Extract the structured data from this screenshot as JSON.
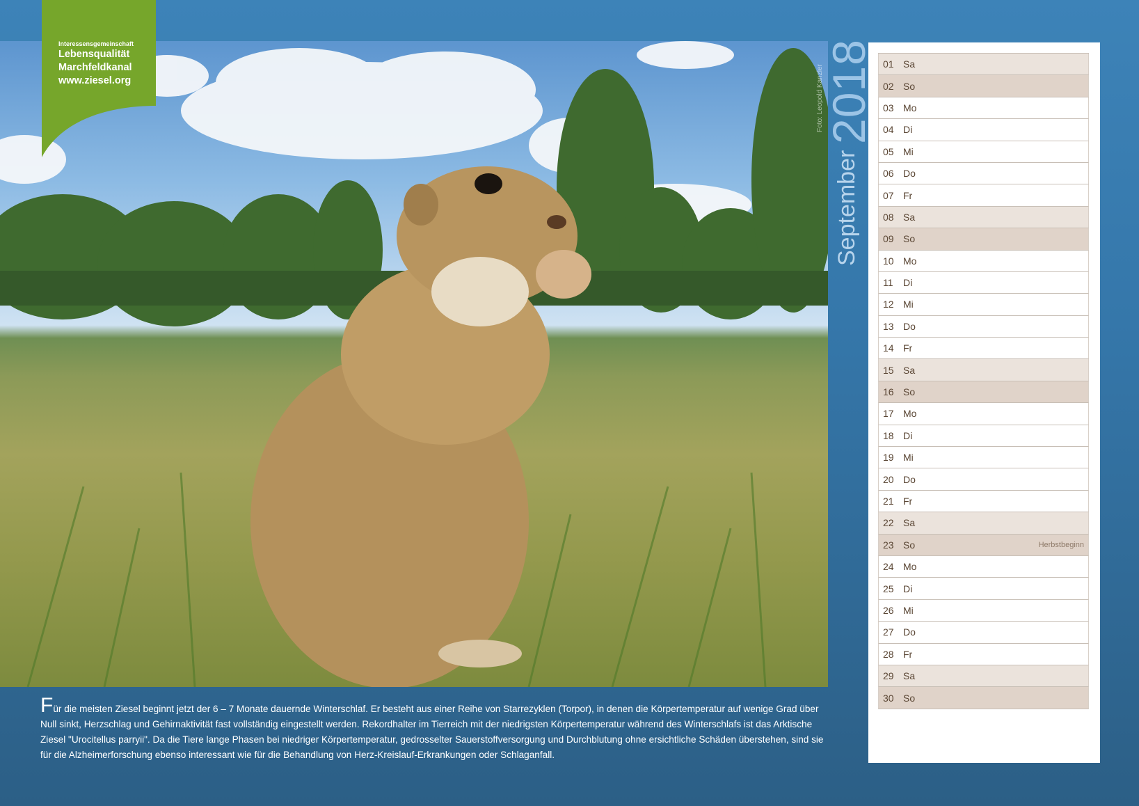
{
  "logo": {
    "line1": "Interessensgemeinschaft",
    "line2": "Lebensqualität",
    "line3": "Marchfeldkanal",
    "line4": "www.ziesel.org",
    "color": "#76a62b"
  },
  "photo": {
    "credit": "Foto: Leopold Kanzler"
  },
  "header": {
    "year": "2018",
    "month": "September"
  },
  "calendar": {
    "days": [
      {
        "num": "01",
        "day": "Sa",
        "type": "sat",
        "note": ""
      },
      {
        "num": "02",
        "day": "So",
        "type": "sun",
        "note": ""
      },
      {
        "num": "03",
        "day": "Mo",
        "type": "week",
        "note": ""
      },
      {
        "num": "04",
        "day": "Di",
        "type": "week",
        "note": ""
      },
      {
        "num": "05",
        "day": "Mi",
        "type": "week",
        "note": ""
      },
      {
        "num": "06",
        "day": "Do",
        "type": "week",
        "note": ""
      },
      {
        "num": "07",
        "day": "Fr",
        "type": "week",
        "note": ""
      },
      {
        "num": "08",
        "day": "Sa",
        "type": "sat",
        "note": ""
      },
      {
        "num": "09",
        "day": "So",
        "type": "sun",
        "note": ""
      },
      {
        "num": "10",
        "day": "Mo",
        "type": "week",
        "note": ""
      },
      {
        "num": "11",
        "day": "Di",
        "type": "week",
        "note": ""
      },
      {
        "num": "12",
        "day": "Mi",
        "type": "week",
        "note": ""
      },
      {
        "num": "13",
        "day": "Do",
        "type": "week",
        "note": ""
      },
      {
        "num": "14",
        "day": "Fr",
        "type": "week",
        "note": ""
      },
      {
        "num": "15",
        "day": "Sa",
        "type": "sat",
        "note": ""
      },
      {
        "num": "16",
        "day": "So",
        "type": "sun",
        "note": ""
      },
      {
        "num": "17",
        "day": "Mo",
        "type": "week",
        "note": ""
      },
      {
        "num": "18",
        "day": "Di",
        "type": "week",
        "note": ""
      },
      {
        "num": "19",
        "day": "Mi",
        "type": "week",
        "note": ""
      },
      {
        "num": "20",
        "day": "Do",
        "type": "week",
        "note": ""
      },
      {
        "num": "21",
        "day": "Fr",
        "type": "week",
        "note": ""
      },
      {
        "num": "22",
        "day": "Sa",
        "type": "sat",
        "note": ""
      },
      {
        "num": "23",
        "day": "So",
        "type": "sun",
        "note": "Herbstbeginn"
      },
      {
        "num": "24",
        "day": "Mo",
        "type": "week",
        "note": ""
      },
      {
        "num": "25",
        "day": "Di",
        "type": "week",
        "note": ""
      },
      {
        "num": "26",
        "day": "Mi",
        "type": "week",
        "note": ""
      },
      {
        "num": "27",
        "day": "Do",
        "type": "week",
        "note": ""
      },
      {
        "num": "28",
        "day": "Fr",
        "type": "week",
        "note": ""
      },
      {
        "num": "29",
        "day": "Sa",
        "type": "sat",
        "note": ""
      },
      {
        "num": "30",
        "day": "So",
        "type": "sun",
        "note": ""
      }
    ]
  },
  "text": {
    "dropcap": "F",
    "body": "ür die meisten Ziesel beginnt jetzt der 6 – 7 Monate dauernde Winterschlaf. Er besteht aus einer Reihe von Starrezyklen (Torpor), in denen die Körpertemperatur auf wenige Grad über Null sinkt, Herzschlag und Gehirnaktivität fast vollständig eingestellt werden. Rekordhalter im Tierreich mit der niedrigsten Körpertemperatur während des Winterschlafs ist das Arktische Ziesel \"Urocitellus parryii\". Da die Tiere lange Phasen bei niedriger Körpertemperatur, gedrosselter Sauerstoffversorgung und Durchblutung ohne ersichtliche Schäden überstehen, sind sie für die Alzheimerforschung ebenso interessant wie für die Behandlung von Herz-Kreislauf-Erkrankungen oder Schlaganfall."
  }
}
